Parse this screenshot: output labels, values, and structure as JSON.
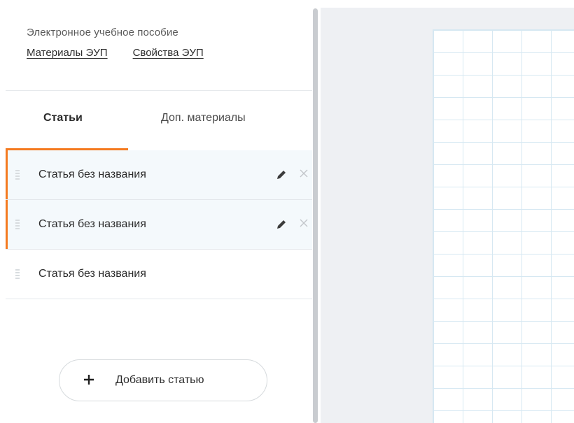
{
  "header": {
    "title": "Электронное учебное пособие",
    "links": [
      {
        "label": "Материалы ЭУП"
      },
      {
        "label": "Свойства ЭУП"
      }
    ]
  },
  "tabs": [
    {
      "label": "Статьи",
      "active": true
    },
    {
      "label": "Доп. материалы",
      "active": false
    }
  ],
  "articles": [
    {
      "title": "Статья без названия",
      "highlighted": true,
      "actions": [
        "pencil-icon",
        "close-icon"
      ]
    },
    {
      "title": "Статья без названия",
      "highlighted": true,
      "actions": [
        "pencil-icon",
        "close-icon"
      ]
    },
    {
      "title": "Статья без названия",
      "highlighted": false,
      "actions": []
    }
  ],
  "add_button": {
    "icon": "plus-icon",
    "label": "Добавить статью"
  },
  "colors": {
    "accent": "#f47a20",
    "row_highlight": "#f4f9fc",
    "canvas_background": "#eef0f3",
    "grid_line": "#d6e8f2"
  }
}
